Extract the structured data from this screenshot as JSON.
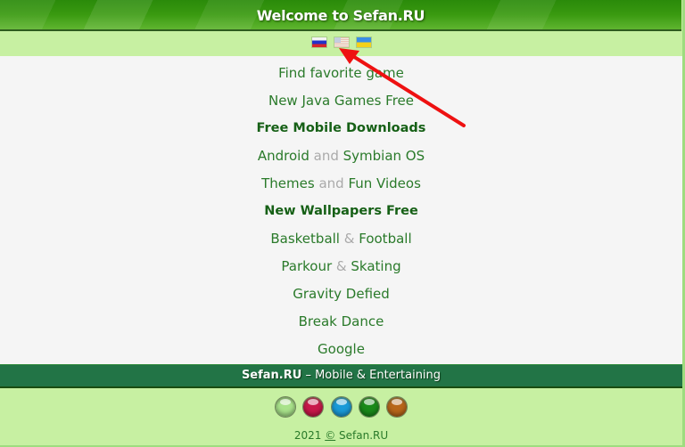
{
  "header": {
    "title": "Welcome to Sefan.RU"
  },
  "languages": [
    {
      "code": "ru",
      "name": "Russian",
      "icon": "flag-russia-icon"
    },
    {
      "code": "en",
      "name": "English",
      "icon": "flag-usa-icon"
    },
    {
      "code": "ua",
      "name": "Ukrainian",
      "icon": "flag-ukraine-icon"
    }
  ],
  "menu": {
    "items": [
      {
        "label": "Find favorite game"
      },
      {
        "label": "New Java Games Free"
      },
      {
        "label": "Free Mobile Downloads"
      },
      {
        "left": "Android",
        "sep": "and",
        "right": "Symbian  OS"
      },
      {
        "left": "Themes",
        "sep": "and",
        "right": "Fun Videos"
      },
      {
        "label": "New Wallpapers Free"
      },
      {
        "left": "Basketball",
        "sep": "&",
        "right": "Football"
      },
      {
        "left": "Parkour",
        "sep": "&",
        "right": "Skating"
      },
      {
        "label": "Gravity Defied"
      },
      {
        "label": "Break Dance"
      },
      {
        "label": "Google"
      }
    ]
  },
  "footer": {
    "brand": "Sefan.RU",
    "tagline": " – Mobile & Entertaining",
    "year": "2021",
    "copyright_symbol": "©",
    "site": "Sefan.RU"
  },
  "theme_balls": [
    {
      "name": "light-green",
      "color": "#a8e28a"
    },
    {
      "name": "pink",
      "color": "#c8184a"
    },
    {
      "name": "cyan",
      "color": "#1a9ad8"
    },
    {
      "name": "green",
      "color": "#1a8a1a"
    },
    {
      "name": "orange",
      "color": "#b8661a"
    }
  ],
  "colors": {
    "accent": "#2a7a2a",
    "header_green": "#3a9a10",
    "footer_green": "#227446",
    "background": "#c7f0a2",
    "annotation_arrow": "#ee1111"
  }
}
